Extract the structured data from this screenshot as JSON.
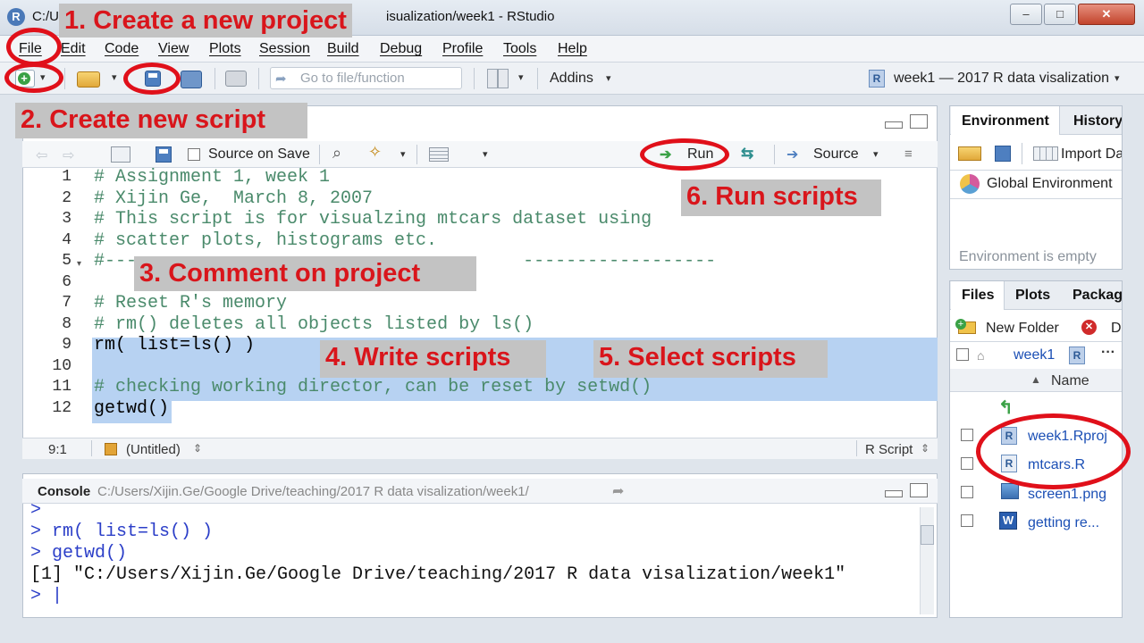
{
  "window": {
    "title_left": "C:/U",
    "title_right": "isualization/week1 - RStudio",
    "controls": [
      "–",
      "□",
      "✕"
    ],
    "app_icon_letter": "R"
  },
  "menu": [
    "File",
    "Edit",
    "Code",
    "View",
    "Plots",
    "Session",
    "Build",
    "Debug",
    "Profile",
    "Tools",
    "Help"
  ],
  "toolbar": {
    "goto_placeholder": "Go to file/function",
    "addins": "Addins",
    "project": "week1 — 2017 R data visalization"
  },
  "editor": {
    "source_on_save": "Source on Save",
    "run": "Run",
    "source": "Source",
    "lines": [
      {
        "n": "1",
        "text": "# Assignment 1, week 1",
        "kind": "comment"
      },
      {
        "n": "2",
        "text": "# Xijin Ge,  March 8, 2007",
        "kind": "comment"
      },
      {
        "n": "3",
        "text": "# This script is for visualzing mtcars dataset using",
        "kind": "comment"
      },
      {
        "n": "4",
        "text": "# scatter plots, histograms etc.",
        "kind": "comment"
      },
      {
        "n": "5",
        "text": "#---                                    ------------------",
        "kind": "comment"
      },
      {
        "n": "6",
        "text": "",
        "kind": "plain"
      },
      {
        "n": "7",
        "text": "# Reset R's memory",
        "kind": "comment"
      },
      {
        "n": "8",
        "text": "# rm() deletes all objects listed by ls()",
        "kind": "comment"
      },
      {
        "n": "9",
        "text": "rm( list=ls() )",
        "kind": "plain"
      },
      {
        "n": "10",
        "text": "",
        "kind": "plain"
      },
      {
        "n": "11",
        "text": "# checking working director, can be reset by setwd()",
        "kind": "comment"
      },
      {
        "n": "12",
        "text": "getwd()",
        "kind": "plain"
      }
    ],
    "status_pos": "9:1",
    "status_file": "(Untitled)",
    "status_type": "R Script"
  },
  "console": {
    "title": "Console",
    "path": "C:/Users/Xijin.Ge/Google Drive/teaching/2017 R data visalization/week1/",
    "lines": [
      ">",
      "> rm( list=ls() )",
      "> getwd()",
      "[1] \"C:/Users/Xijin.Ge/Google Drive/teaching/2017 R data visalization/week1\"",
      "> |"
    ]
  },
  "env_pane": {
    "tabs": [
      "Environment",
      "History"
    ],
    "import": "Import Da",
    "scope": "Global Environment",
    "empty_msg": "Environment is empty"
  },
  "files_pane": {
    "tabs": [
      "Files",
      "Plots",
      "Packag"
    ],
    "new_folder": "New Folder",
    "delete": "D",
    "breadcrumb": "week1",
    "col_name": "Name",
    "up_label": "..",
    "files": [
      "week1.Rproj",
      "mtcars.R",
      "screen1.png",
      "getting re..."
    ]
  },
  "annotations": {
    "a1": "1. Create a new project",
    "a2": "2. Create new script",
    "a3": "3. Comment on project",
    "a4": "4. Write scripts",
    "a5": "5. Select scripts",
    "a6": "6. Run scripts"
  }
}
